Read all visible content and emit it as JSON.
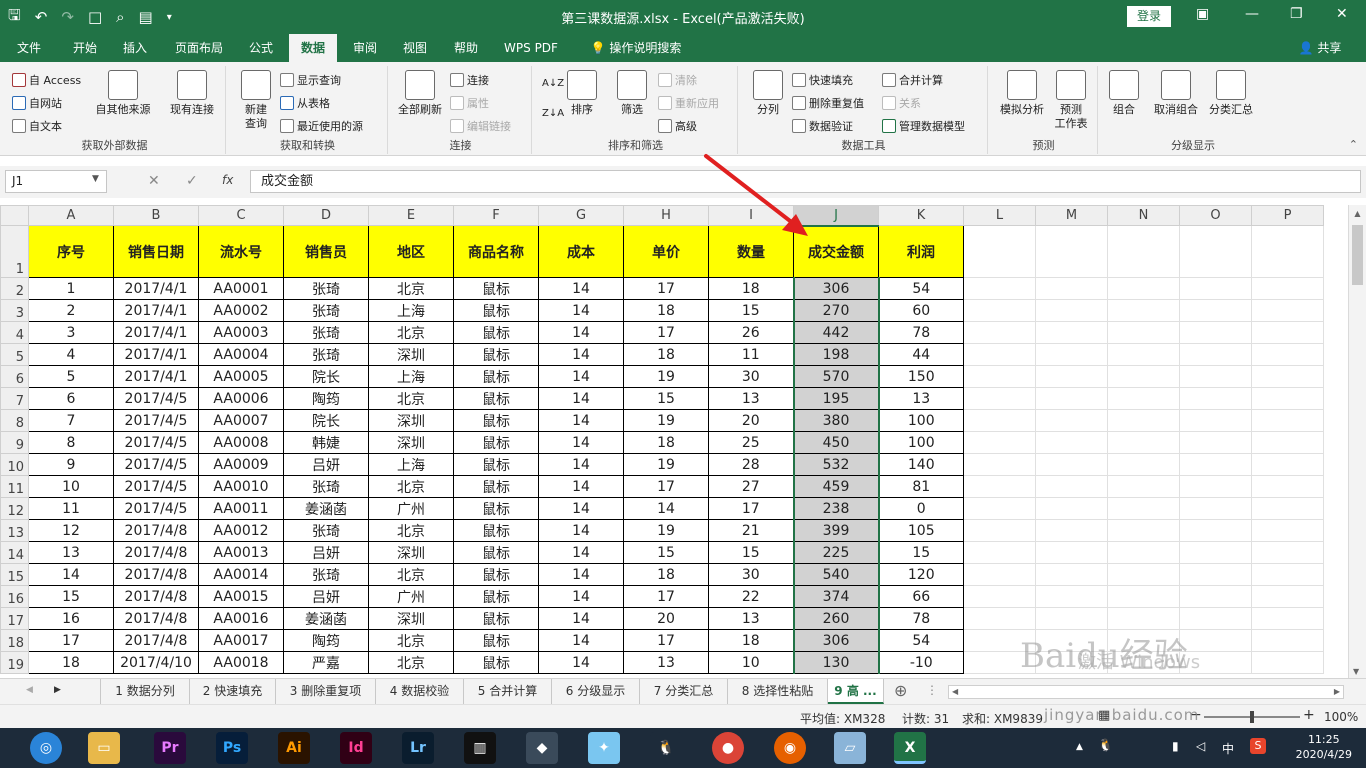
{
  "window": {
    "title": "第三课数据源.xlsx  -  Excel(产品激活失败)",
    "login_label": "登录"
  },
  "tabs": [
    "文件",
    "开始",
    "插入",
    "页面布局",
    "公式",
    "数据",
    "审阅",
    "视图",
    "帮助",
    "WPS PDF"
  ],
  "tell_me": "操作说明搜索",
  "share": "共享",
  "ribbon": {
    "g1": {
      "label": "获取外部数据",
      "access": "自 Access",
      "web": "自网站",
      "text": "自文本",
      "other": "自其他来源",
      "existing": "现有连接"
    },
    "g2": {
      "label": "获取和转换",
      "new_query": "新建\n查询",
      "show_query": "显示查询",
      "from_table": "从表格",
      "recent": "最近使用的源"
    },
    "g3": {
      "label": "连接",
      "refresh_all": "全部刷新",
      "connections": "连接",
      "properties": "属性",
      "edit_links": "编辑链接"
    },
    "g4": {
      "label": "排序和筛选",
      "sort": "排序",
      "filter": "筛选",
      "clear": "清除",
      "reapply": "重新应用",
      "advanced": "高级"
    },
    "g5": {
      "label": "数据工具",
      "split": "分列",
      "flash_fill": "快速填充",
      "remove_dup": "删除重复值",
      "validate": "数据验证",
      "consolidate": "合并计算",
      "relations": "关系",
      "data_model": "管理数据模型"
    },
    "g6": {
      "label": "预测",
      "whatif": "模拟分析",
      "forecast": "预测\n工作表"
    },
    "g7": {
      "label": "分级显示",
      "group": "组合",
      "ungroup": "取消组合",
      "subtotal": "分类汇总"
    }
  },
  "formula_bar": {
    "name_box": "J1",
    "fx": "fx",
    "content": "成交金额"
  },
  "columns": [
    "A",
    "B",
    "C",
    "D",
    "E",
    "F",
    "G",
    "H",
    "I",
    "J",
    "K",
    "L",
    "M",
    "N",
    "O",
    "P"
  ],
  "headers": [
    "序号",
    "销售日期",
    "流水号",
    "销售员",
    "地区",
    "商品名称",
    "成本",
    "单价",
    "数量",
    "成交金额",
    "利润"
  ],
  "rows": [
    [
      "1",
      "2017/4/1",
      "AA0001",
      "张琦",
      "北京",
      "鼠标",
      "14",
      "17",
      "18",
      "306",
      "54"
    ],
    [
      "2",
      "2017/4/1",
      "AA0002",
      "张琦",
      "上海",
      "鼠标",
      "14",
      "18",
      "15",
      "270",
      "60"
    ],
    [
      "3",
      "2017/4/1",
      "AA0003",
      "张琦",
      "北京",
      "鼠标",
      "14",
      "17",
      "26",
      "442",
      "78"
    ],
    [
      "4",
      "2017/4/1",
      "AA0004",
      "张琦",
      "深圳",
      "鼠标",
      "14",
      "18",
      "11",
      "198",
      "44"
    ],
    [
      "5",
      "2017/4/1",
      "AA0005",
      "院长",
      "上海",
      "鼠标",
      "14",
      "19",
      "30",
      "570",
      "150"
    ],
    [
      "6",
      "2017/4/5",
      "AA0006",
      "陶筠",
      "北京",
      "鼠标",
      "14",
      "15",
      "13",
      "195",
      "13"
    ],
    [
      "7",
      "2017/4/5",
      "AA0007",
      "院长",
      "深圳",
      "鼠标",
      "14",
      "19",
      "20",
      "380",
      "100"
    ],
    [
      "8",
      "2017/4/5",
      "AA0008",
      "韩婕",
      "深圳",
      "鼠标",
      "14",
      "18",
      "25",
      "450",
      "100"
    ],
    [
      "9",
      "2017/4/5",
      "AA0009",
      "吕妍",
      "上海",
      "鼠标",
      "14",
      "19",
      "28",
      "532",
      "140"
    ],
    [
      "10",
      "2017/4/5",
      "AA0010",
      "张琦",
      "北京",
      "鼠标",
      "14",
      "17",
      "27",
      "459",
      "81"
    ],
    [
      "11",
      "2017/4/5",
      "AA0011",
      "姜涵菡",
      "广州",
      "鼠标",
      "14",
      "14",
      "17",
      "238",
      "0"
    ],
    [
      "12",
      "2017/4/8",
      "AA0012",
      "张琦",
      "北京",
      "鼠标",
      "14",
      "19",
      "21",
      "399",
      "105"
    ],
    [
      "13",
      "2017/4/8",
      "AA0013",
      "吕妍",
      "深圳",
      "鼠标",
      "14",
      "15",
      "15",
      "225",
      "15"
    ],
    [
      "14",
      "2017/4/8",
      "AA0014",
      "张琦",
      "北京",
      "鼠标",
      "14",
      "18",
      "30",
      "540",
      "120"
    ],
    [
      "15",
      "2017/4/8",
      "AA0015",
      "吕妍",
      "广州",
      "鼠标",
      "14",
      "17",
      "22",
      "374",
      "66"
    ],
    [
      "16",
      "2017/4/8",
      "AA0016",
      "姜涵菡",
      "深圳",
      "鼠标",
      "14",
      "20",
      "13",
      "260",
      "78"
    ],
    [
      "17",
      "2017/4/8",
      "AA0017",
      "陶筠",
      "北京",
      "鼠标",
      "14",
      "17",
      "18",
      "306",
      "54"
    ],
    [
      "18",
      "2017/4/10",
      "AA0018",
      "严嘉",
      "北京",
      "鼠标",
      "14",
      "13",
      "10",
      "130",
      "-10"
    ]
  ],
  "sheet_tabs": [
    "1 数据分列",
    "2 快速填充",
    "3 删除重复项",
    "4 数据校验",
    "5 合并计算",
    "6 分级显示",
    "7 分类汇总",
    "8 选择性粘贴",
    "9 高 ..."
  ],
  "status": {
    "average": "平均值: XM328",
    "count": "计数: 31",
    "sum": "求和: XM9839",
    "zoom": "100%"
  },
  "taskbar": {
    "time": "11:25",
    "date": "2020/4/29",
    "ime": "中"
  },
  "watermark": {
    "main": "Baidu经验",
    "activate": "激活 Windows",
    "url": "jingyan.baidu.com"
  },
  "colors": {
    "excel_green": "#217346",
    "header_fill": "#ffff00",
    "selection": "#d2d2d2",
    "arrow": "#e02020"
  }
}
